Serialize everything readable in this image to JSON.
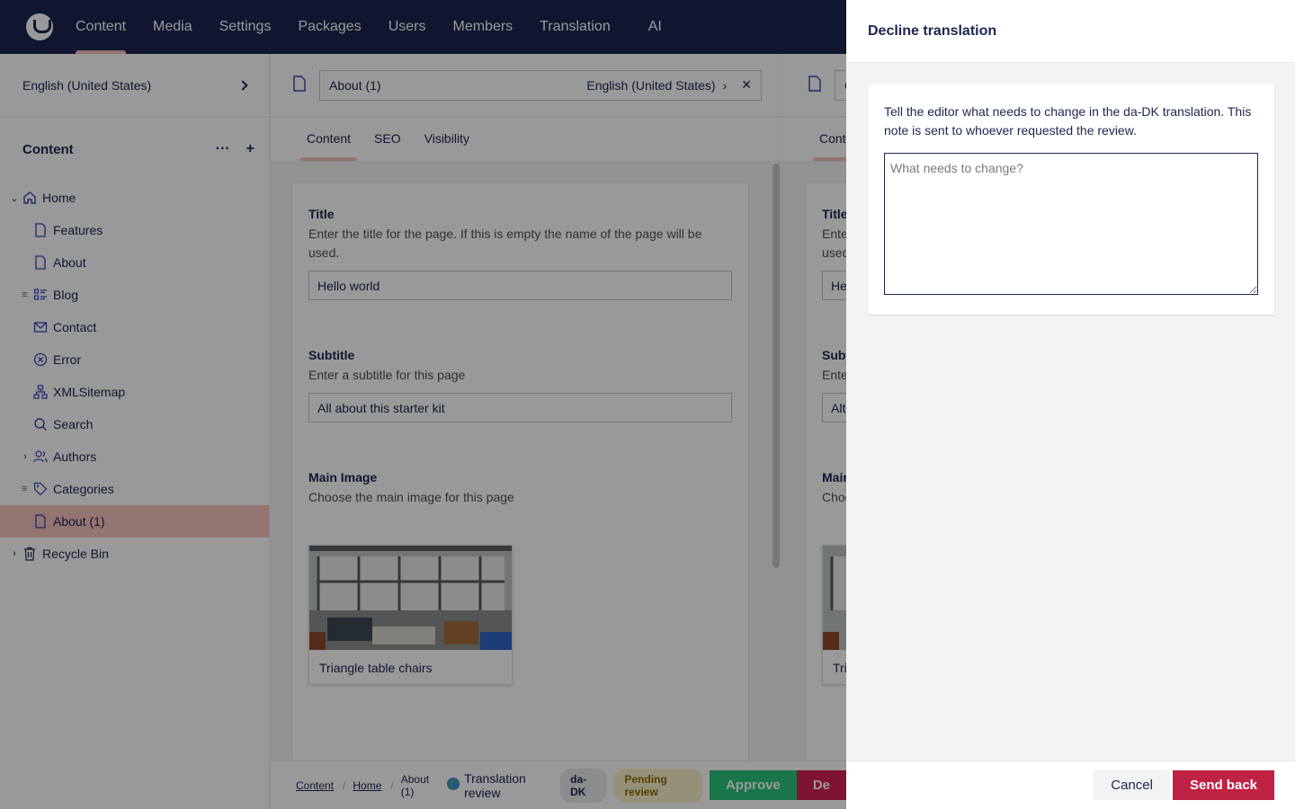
{
  "header": {
    "nav": [
      "Content",
      "Media",
      "Settings",
      "Packages",
      "Users",
      "Members",
      "Translation",
      "AI"
    ],
    "active_nav": "Content"
  },
  "sidebar": {
    "culture": "English (United States)",
    "section_title": "Content",
    "tree": [
      {
        "label": "Home",
        "icon": "home-icon"
      },
      {
        "label": "Features",
        "icon": "document-icon"
      },
      {
        "label": "About",
        "icon": "document-icon"
      },
      {
        "label": "Blog",
        "icon": "list-icon"
      },
      {
        "label": "Contact",
        "icon": "mail-icon"
      },
      {
        "label": "Error",
        "icon": "error-icon"
      },
      {
        "label": "XMLSitemap",
        "icon": "sitemap-icon"
      },
      {
        "label": "Search",
        "icon": "search-icon"
      },
      {
        "label": "Authors",
        "icon": "users-icon"
      },
      {
        "label": "Categories",
        "icon": "tag-icon"
      },
      {
        "label": "About (1)",
        "icon": "document-icon"
      },
      {
        "label": "Recycle Bin",
        "icon": "trash-icon"
      }
    ]
  },
  "editor": {
    "name": "About (1)",
    "culture": "English (United States)",
    "tabs": [
      "Content",
      "SEO",
      "Visibility"
    ],
    "title_label": "Title",
    "title_desc": "Enter the title for the page. If this is empty the name of the page will be used.",
    "title_value": "Hello world",
    "subtitle_label": "Subtitle",
    "subtitle_desc": "Enter a subtitle for this page",
    "subtitle_value": "All about this starter kit",
    "image_label": "Main Image",
    "image_desc": "Choose the main image for this page",
    "image_caption": "Triangle table chairs"
  },
  "right_pane": {
    "name_fragment": "C",
    "tab_fragment": "Cont",
    "title_fragment": "Title",
    "desc_fragment_1": "Ente",
    "desc_fragment_2": "used",
    "value_fragment": "He",
    "subtitle_fragment": "Subt",
    "subdesc_fragment": "Ente",
    "subvalue_fragment": "Alt",
    "image_fragment": "Mair",
    "image_desc_fragment": "Choo",
    "caption_fragment": "Tri"
  },
  "footer": {
    "crumbs": [
      "Content",
      "Home"
    ],
    "current": "About (1)",
    "review_label": "Translation review",
    "locale_badge": "da-DK",
    "status_badge": "Pending review",
    "approve_label": "Approve",
    "decline_label": "De"
  },
  "modal": {
    "title": "Decline translation",
    "instruction": "Tell the editor what needs to change in the da-DK translation. This note is sent to whoever requested the review.",
    "placeholder": "What needs to change?",
    "value": "",
    "cancel_label": "Cancel",
    "send_label": "Send back"
  },
  "colors": {
    "header_bg": "#1b264f",
    "accent": "#f5c1bc",
    "approve": "#2bc37c",
    "danger": "#bf2242"
  }
}
